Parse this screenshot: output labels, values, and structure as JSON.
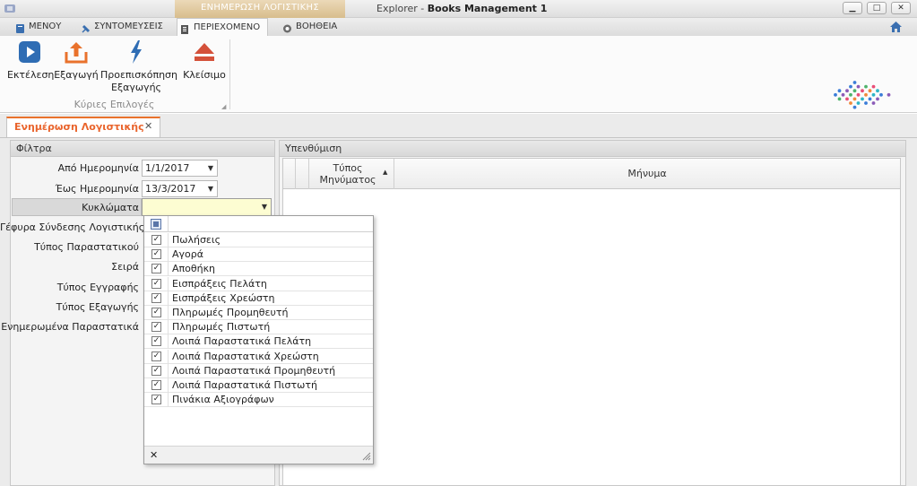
{
  "window": {
    "context_title": "ΕΝΗΜΕΡΩΣΗ ΛΟΓΙΣΤΙΚΗΣ",
    "app_prefix": "Explorer - ",
    "app_name": "Books Management 1",
    "controls": {
      "minimize": "▁",
      "maximize": "□",
      "close": "✕"
    }
  },
  "menu": {
    "tabs": [
      {
        "label": "ΜΕΝΟΥ",
        "icon": "book-icon"
      },
      {
        "label": "ΣΥΝΤΟΜΕΥΣΕΙΣ",
        "icon": "pin-icon"
      },
      {
        "label": "ΠΕΡΙΕΧΟΜΕΝΟ",
        "icon": "document-icon",
        "active": true
      },
      {
        "label": "ΒΟΗΘΕΙΑ",
        "icon": "lifebuoy-icon"
      }
    ]
  },
  "ribbon": {
    "buttons": [
      {
        "label": "Εκτέλεση",
        "icon": "play-icon"
      },
      {
        "label": "Εξαγωγή",
        "icon": "export-icon"
      },
      {
        "label": "Προεπισκόπηση Εξαγωγής",
        "icon": "lightning-icon"
      },
      {
        "label": "Κλείσιμο",
        "icon": "eject-icon"
      }
    ],
    "group_label": "Κύριες Επιλογές"
  },
  "document_tab": {
    "label": "Ενημέρωση Λογιστικής"
  },
  "filters": {
    "title": "Φίλτρα",
    "from_date_label": "Από Ημερομηνία",
    "from_date_value": "1/1/2017",
    "to_date_label": "Έως Ημερομηνία",
    "to_date_value": "13/3/2017",
    "circuits_label": "Κυκλώματα",
    "circuits_value": "",
    "bridge_label": "Γέφυρα Σύνδεσης Λογιστικής",
    "doc_type_label": "Τύπος Παραστατικού",
    "series_label": "Σειρά",
    "entry_type_label": "Τύπος Εγγραφής",
    "export_type_label": "Τύπος Εξαγωγής",
    "updated_docs_label": "Ενημερωμένα Παραστατικά"
  },
  "circuits_dropdown": {
    "items": [
      {
        "label": "Πωλήσεις",
        "checked": true
      },
      {
        "label": "Αγορά",
        "checked": true
      },
      {
        "label": "Αποθήκη",
        "checked": true
      },
      {
        "label": "Εισπράξεις Πελάτη",
        "checked": true
      },
      {
        "label": "Εισπράξεις Χρεώστη",
        "checked": true
      },
      {
        "label": "Πληρωμές Προμηθευτή",
        "checked": true
      },
      {
        "label": "Πληρωμές Πιστωτή",
        "checked": true
      },
      {
        "label": "Λοιπά Παραστατικά Πελάτη",
        "checked": true
      },
      {
        "label": "Λοιπά Παραστατικά Χρεώστη",
        "checked": true
      },
      {
        "label": "Λοιπά Παραστατικά Προμηθευτή",
        "checked": true
      },
      {
        "label": "Λοιπά Παραστατικά Πιστωτή",
        "checked": true
      },
      {
        "label": "Πινάκια Αξιογράφων",
        "checked": true
      }
    ],
    "check_mark": "✓",
    "clear_glyph": "✕"
  },
  "reminder": {
    "title": "Υπενθύμιση",
    "col_type": "Τύπος Μηνύματος",
    "col_message": "Μήνυμα"
  },
  "colors": {
    "accent": "#e9722c",
    "selection": "#fdfdd2"
  }
}
